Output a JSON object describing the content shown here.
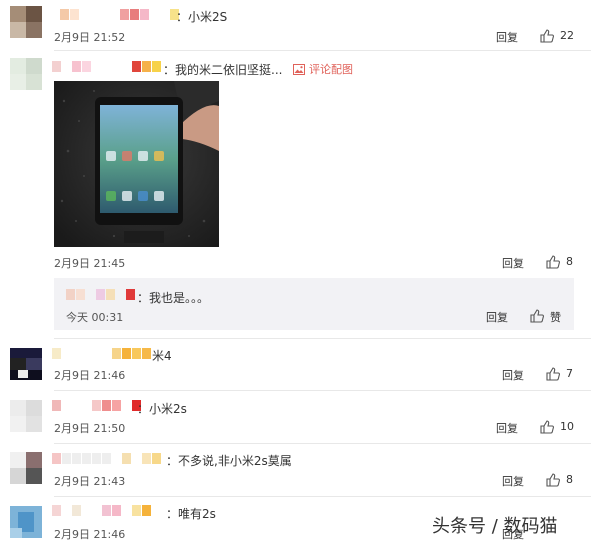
{
  "colors": {
    "link": "#e0625a",
    "separator": "#e8e8e8",
    "subbox": "#f2f2f5"
  },
  "comments": [
    {
      "content": "：小米2S",
      "time": "2月9日 21:52",
      "reply": "回复",
      "likes": "22"
    },
    {
      "content": "：我的米二依旧坚挺...",
      "pic_link": "评论配图",
      "time": "2月9日 21:45",
      "reply": "回复",
      "likes": "8",
      "sub": {
        "content": "：我也是。。。",
        "time": "今天 00:31",
        "reply": "回复",
        "like_label": "赞"
      }
    },
    {
      "content": "米4",
      "time": "2月9日 21:46",
      "reply": "回复",
      "likes": "7"
    },
    {
      "content": "：小米2s",
      "time": "2月9日 21:50",
      "reply": "回复",
      "likes": "10"
    },
    {
      "content": "：不多说,非小米2s莫属",
      "time": "2月9日 21:43",
      "reply": "回复",
      "likes": "8"
    },
    {
      "content": "：唯有2s",
      "time": "2月9日 21:46",
      "reply": "回复"
    }
  ],
  "watermark": {
    "text": "头条号 / 数码猫"
  },
  "icons": {
    "like": "thumbs-up-icon",
    "pic": "picture-icon",
    "watermark": "toutiao-logo-icon"
  }
}
